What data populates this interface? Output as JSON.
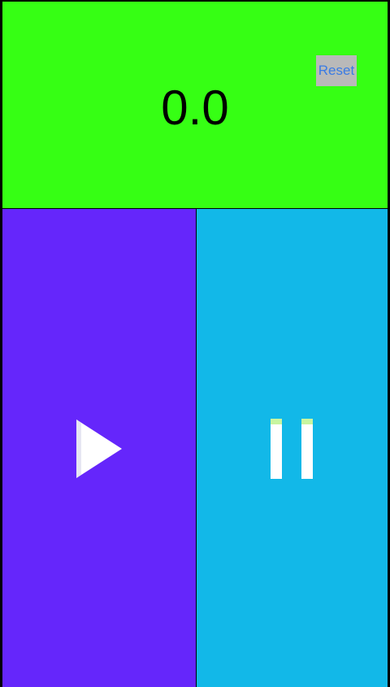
{
  "timer": {
    "value": "0.0"
  },
  "reset": {
    "label": "Reset"
  },
  "controls": {
    "play_icon": "play-icon",
    "pause_icon": "pause-icon"
  },
  "colors": {
    "top_panel": "#36ff14",
    "play_panel": "#6526fb",
    "pause_panel": "#12b8e8",
    "reset_text": "#3a7be4",
    "reset_bg": "#b9b9b9"
  }
}
